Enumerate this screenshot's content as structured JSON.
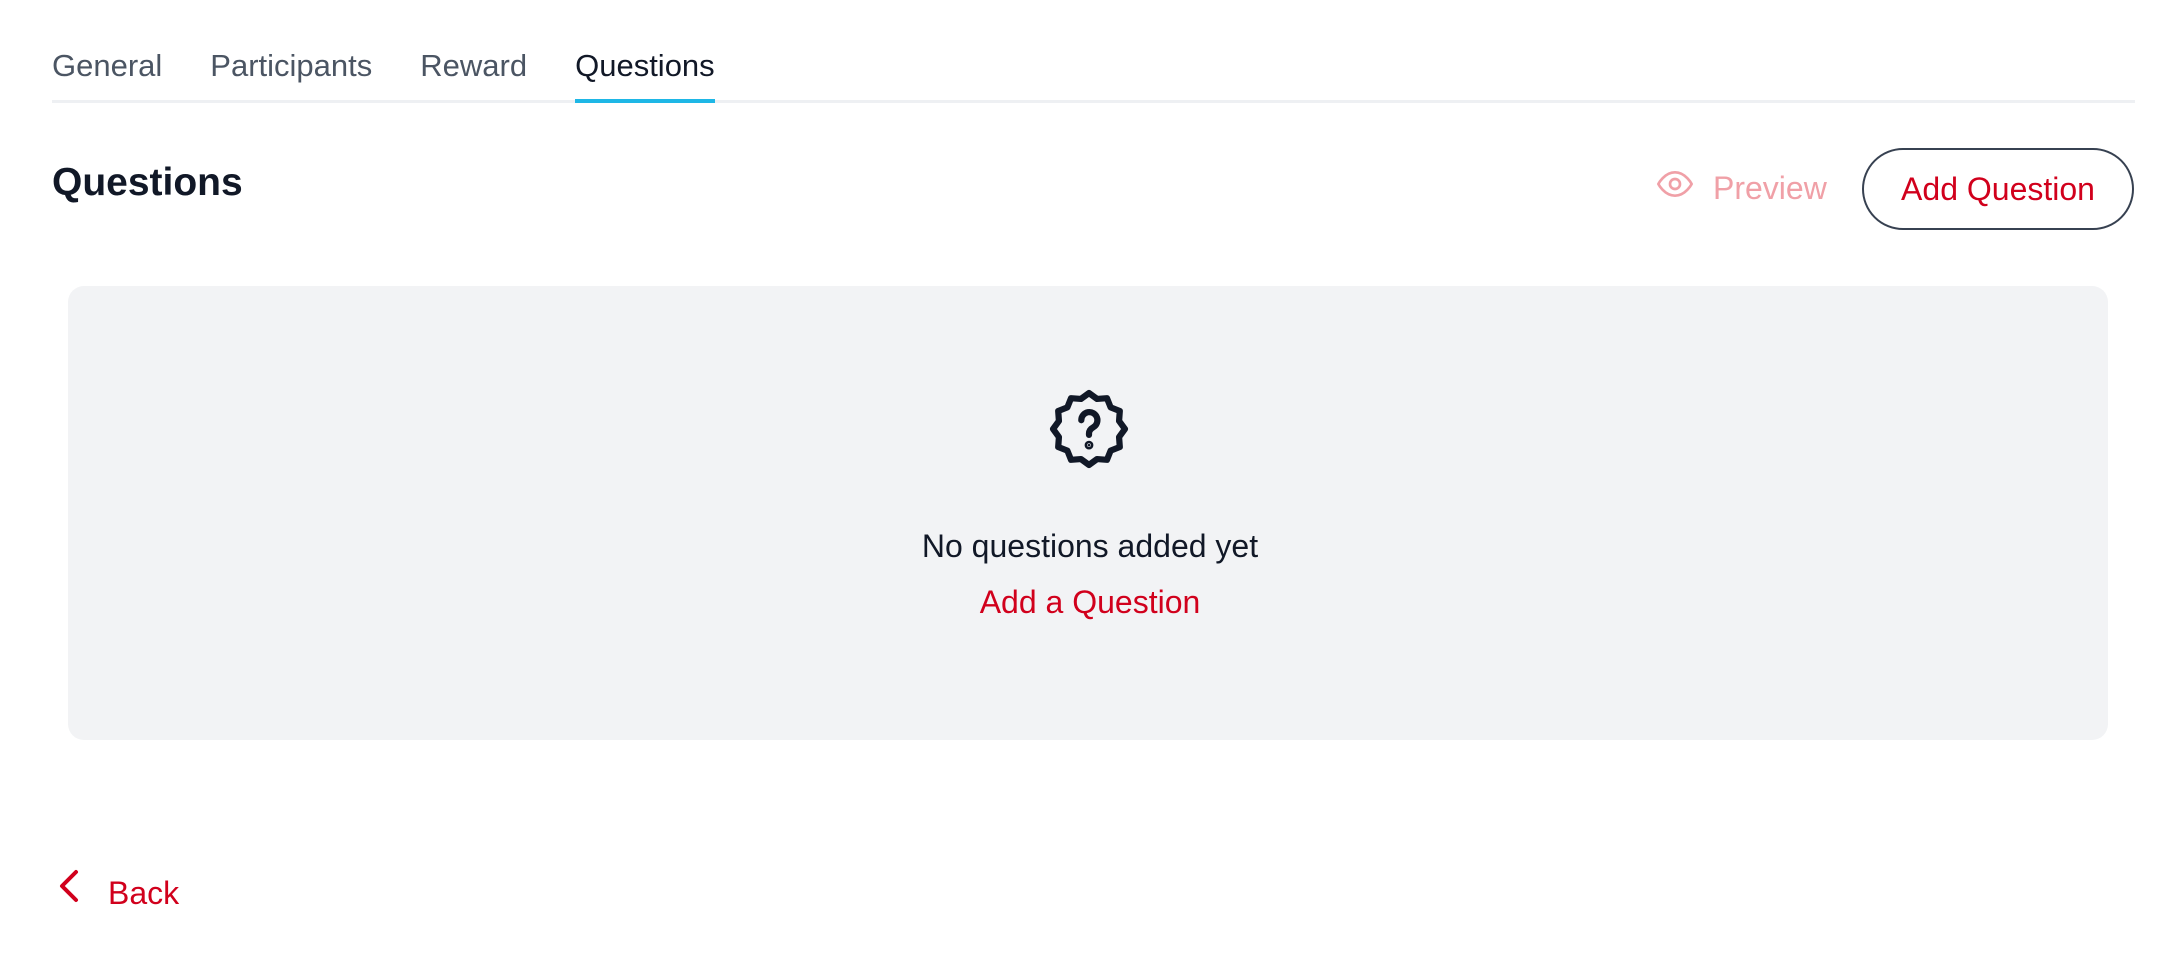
{
  "tabs": [
    {
      "label": "General",
      "active": false
    },
    {
      "label": "Participants",
      "active": false
    },
    {
      "label": "Reward",
      "active": false
    },
    {
      "label": "Questions",
      "active": true
    }
  ],
  "section": {
    "title": "Questions"
  },
  "toolbar": {
    "preview_label": "Preview",
    "preview_icon": "eye-icon",
    "add_question_label": "Add Question"
  },
  "empty_state": {
    "icon": "question-badge-icon",
    "message": "No questions added yet",
    "link_label": "Add a Question"
  },
  "footer": {
    "back_label": "Back",
    "back_icon": "chevron-left-icon"
  },
  "colors": {
    "accent": "#d1001c",
    "tab_indicator": "#1eb7e6",
    "preview_disabled": "#f0a0a7",
    "panel_bg": "#f2f3f5"
  }
}
